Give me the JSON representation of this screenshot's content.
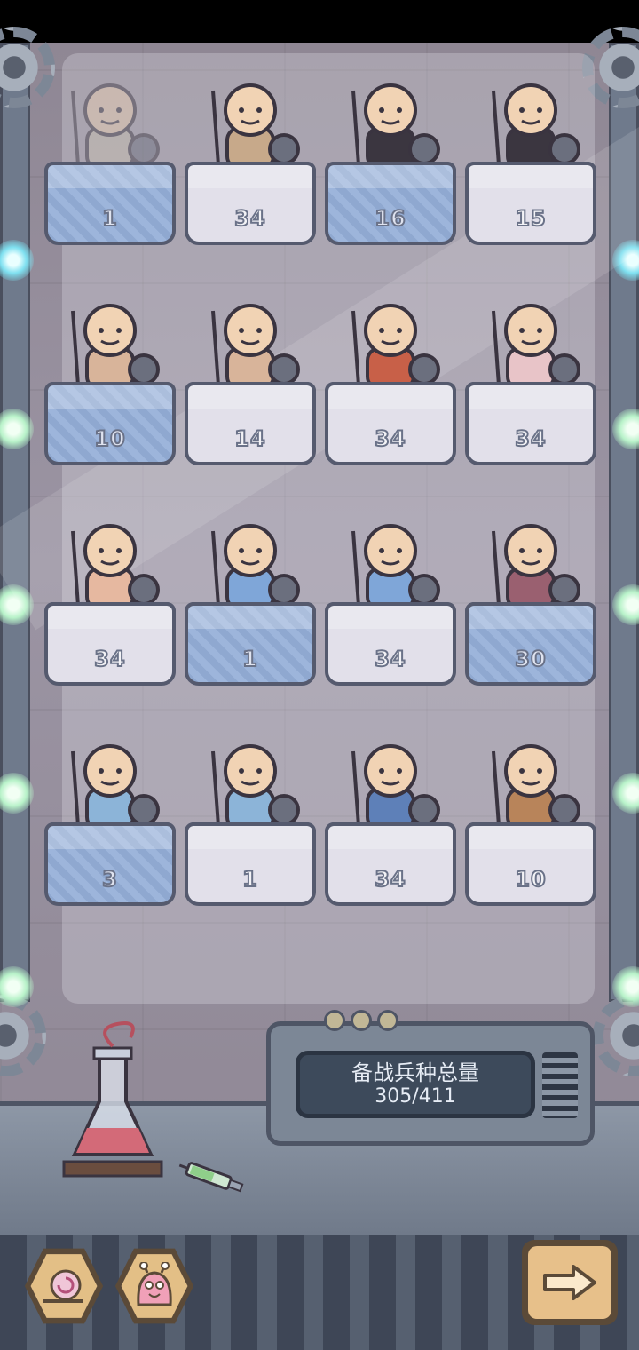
{
  "panel": {
    "title": "备战兵种总量",
    "total": "305/411"
  },
  "units": [
    {
      "count": "1",
      "card": "blue"
    },
    {
      "count": "34",
      "card": "white"
    },
    {
      "count": "16",
      "card": "blue"
    },
    {
      "count": "15",
      "card": "white"
    },
    {
      "count": "10",
      "card": "blue"
    },
    {
      "count": "14",
      "card": "white"
    },
    {
      "count": "34",
      "card": "white"
    },
    {
      "count": "34",
      "card": "white"
    },
    {
      "count": "34",
      "card": "white"
    },
    {
      "count": "1",
      "card": "blue"
    },
    {
      "count": "34",
      "card": "white"
    },
    {
      "count": "30",
      "card": "blue"
    },
    {
      "count": "3",
      "card": "blue"
    },
    {
      "count": "1",
      "card": "white"
    },
    {
      "count": "34",
      "card": "white"
    },
    {
      "count": "10",
      "card": "white"
    }
  ],
  "icons": {
    "snail_button": "snail-icon",
    "slug_button": "slug-icon",
    "next_button": "arrow-right-icon"
  },
  "colors": {
    "card_blue": "#9db5db",
    "card_white": "#e2e0ea",
    "button_gold": "#e7c08a",
    "screen_bg": "#3d4a5b"
  }
}
